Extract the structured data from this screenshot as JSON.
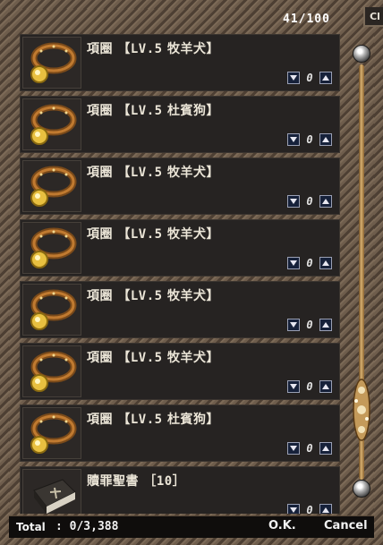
{
  "header": {
    "count_label": "41/100",
    "close_label": "Cl"
  },
  "items": [
    {
      "name": "項圈",
      "lv": "【LV.5",
      "pet": "牧羊犬】",
      "qty": "0",
      "icon": "collar-icon"
    },
    {
      "name": "項圈",
      "lv": "【LV.5",
      "pet": "杜賓狗】",
      "qty": "0",
      "icon": "collar-icon"
    },
    {
      "name": "項圈",
      "lv": "【LV.5",
      "pet": "牧羊犬】",
      "qty": "0",
      "icon": "collar-icon"
    },
    {
      "name": "項圈",
      "lv": "【LV.5",
      "pet": "牧羊犬】",
      "qty": "0",
      "icon": "collar-icon"
    },
    {
      "name": "項圈",
      "lv": "【LV.5",
      "pet": "牧羊犬】",
      "qty": "0",
      "icon": "collar-icon"
    },
    {
      "name": "項圈",
      "lv": "【LV.5",
      "pet": "牧羊犬】",
      "qty": "0",
      "icon": "collar-icon"
    },
    {
      "name": "項圈",
      "lv": "【LV.5",
      "pet": "杜賓狗】",
      "qty": "0",
      "icon": "collar-icon"
    },
    {
      "name": "贖罪聖書",
      "lv": "［10］",
      "pet": "",
      "qty": "0",
      "icon": "holy-book-icon"
    }
  ],
  "footer": {
    "total_label": "Total",
    "total_value": ": 0/3,388",
    "ok_label": "O.K.",
    "cancel_label": "Cancel"
  },
  "colors": {
    "frame": "#5a4a3a",
    "row_bg": "#262322",
    "gold": "#d7b070",
    "stepper_bg": "#16213a"
  }
}
